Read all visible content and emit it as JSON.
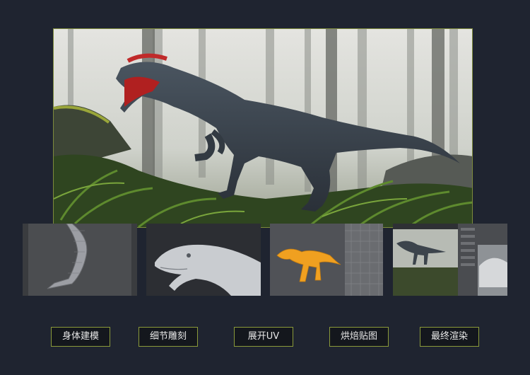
{
  "steps": [
    {
      "label": "身体建模"
    },
    {
      "label": "细节雕刻"
    },
    {
      "label": "展开UV"
    },
    {
      "label": "烘焙贴图"
    },
    {
      "label": "最终渲染"
    }
  ],
  "colors": {
    "background": "#1f2430",
    "accent_border": "#8a9a3a",
    "button_fill": "#14171d",
    "button_text": "#e8e8e8",
    "wireframe_orange": "#f0a020"
  }
}
